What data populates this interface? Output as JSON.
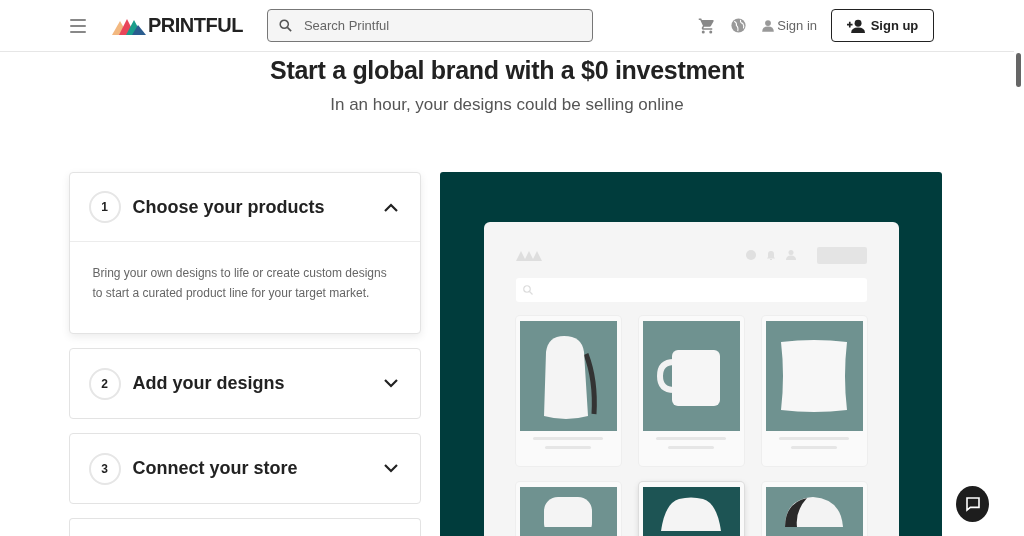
{
  "header": {
    "logo": "PRINTFUL",
    "search": {
      "placeholder": "Search Printful"
    },
    "sign_in": "Sign in",
    "sign_up": "Sign up"
  },
  "hero": {
    "title": "Start a global brand with a $0 investment",
    "subtitle": "In an hour, your designs could be selling online"
  },
  "steps": [
    {
      "number": "1",
      "title": "Choose your products",
      "expanded": true,
      "description": "Bring your own designs to life or create custom designs to start a curated product line for your target market."
    },
    {
      "number": "2",
      "title": "Add your designs",
      "expanded": false
    },
    {
      "number": "3",
      "title": "Connect your store",
      "expanded": false
    }
  ],
  "more_steps_below": true,
  "mockup": {
    "products": [
      {
        "kind": "backpack",
        "highlighted": false
      },
      {
        "kind": "mug",
        "highlighted": false
      },
      {
        "kind": "pillow",
        "highlighted": false
      },
      {
        "kind": "case",
        "highlighted": false
      },
      {
        "kind": "sweatshirt",
        "highlighted": true
      },
      {
        "kind": "cap",
        "highlighted": false
      }
    ]
  }
}
